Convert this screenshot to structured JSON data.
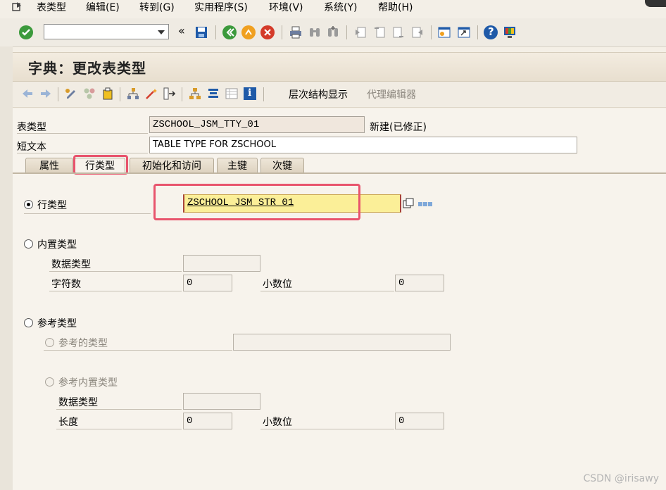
{
  "menu": {
    "items": [
      "表类型",
      "编辑(E)",
      "转到(G)",
      "实用程序(S)",
      "环境(V)",
      "系统(Y)",
      "帮助(H)"
    ]
  },
  "toolbar": {
    "command_value": "",
    "icons": [
      "enter-icon",
      "save-icon",
      "back-icon",
      "exit-icon",
      "cancel-icon",
      "print-icon",
      "find-icon",
      "find-next-icon",
      "first-page-icon",
      "prev-page-icon",
      "next-page-icon",
      "last-page-icon",
      "create-session-icon",
      "shortcut-icon",
      "help-icon",
      "customize-icon"
    ]
  },
  "page": {
    "title": "字典：更改表类型"
  },
  "app_toolbar": {
    "hierarchy_label": "层次结构显示",
    "proxy_label": "代理编辑器"
  },
  "form": {
    "table_type_label": "表类型",
    "table_type_value": "ZSCHOOL_JSM_TTY_01",
    "status_text": "新建(已修正)",
    "short_text_label": "短文本",
    "short_text_value": "TABLE TYPE FOR ZSCHOOL"
  },
  "tabs": [
    "属性",
    "行类型",
    "初始化和访问",
    "主键",
    "次键"
  ],
  "line_type": {
    "row_type_label": "行类型",
    "row_type_value": "ZSCHOOL_JSM_STR_01",
    "builtin_type_label": "内置类型",
    "data_type_label": "数据类型",
    "data_type_value": "",
    "length_label": "字符数",
    "length_value": "0",
    "decimals_label": "小数位",
    "decimals_value": "0",
    "ref_type_label": "参考类型",
    "ref_to_type_label": "参考的类型",
    "ref_to_type_value": "",
    "ref_builtin_label": "参考内置类型",
    "ref_data_type_label": "数据类型",
    "ref_data_type_value": "",
    "ref_length_label": "长度",
    "ref_length_value": "0",
    "ref_decimals_label": "小数位",
    "ref_decimals_value": "0"
  },
  "watermark": "CSDN @irisawy"
}
